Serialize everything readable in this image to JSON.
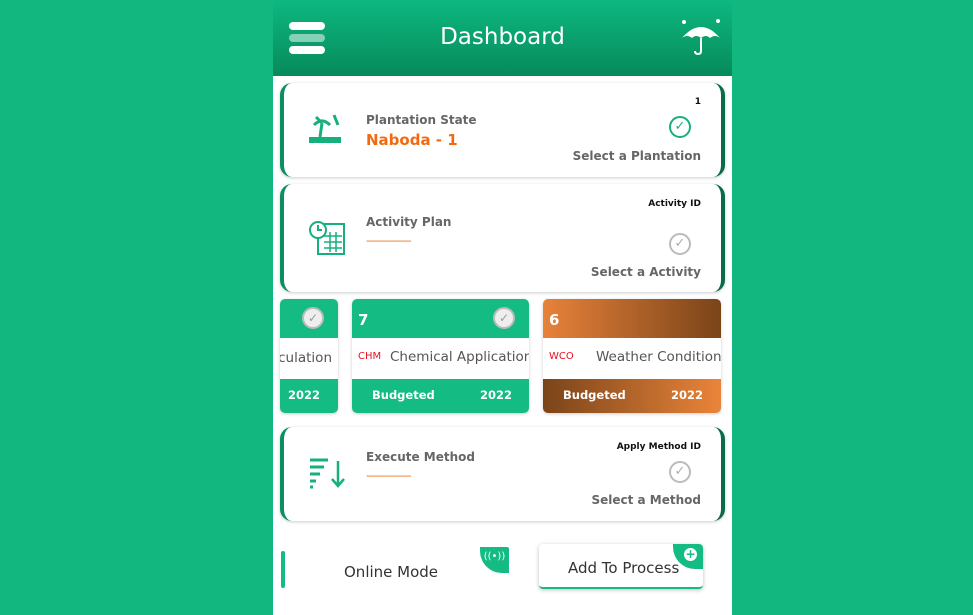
{
  "header": {
    "title": "Dashboard",
    "menu_icon": "hamburger-icon",
    "weather_icon": "umbrella-rain-icon"
  },
  "plantation": {
    "label": "Plantation State",
    "value": "Naboda - 1",
    "count": "1",
    "select": "Select a Plantation"
  },
  "activity": {
    "label": "Activity Plan",
    "value": "---------------",
    "id_label": "Activity ID",
    "select": "Select a Activity"
  },
  "tiles": [
    {
      "number": "",
      "code": "",
      "name": "oculation",
      "status": "",
      "year": "2022",
      "theme": "green"
    },
    {
      "number": "7",
      "code": "CHM",
      "name": "Chemical Application",
      "status": "Budgeted",
      "year": "2022",
      "theme": "green"
    },
    {
      "number": "6",
      "code": "WCO",
      "name": "Weather Condition",
      "status": "Budgeted",
      "year": "2022",
      "theme": "orange"
    }
  ],
  "method": {
    "label": "Execute Method",
    "value": "---------------",
    "id_label": "Apply Method ID",
    "select": "Select a Method"
  },
  "footer": {
    "mode": "Online Mode",
    "add": "Add To Process"
  },
  "colors": {
    "brand": "#14bb83",
    "accent": "#f26a10",
    "code": "#e8101e"
  }
}
